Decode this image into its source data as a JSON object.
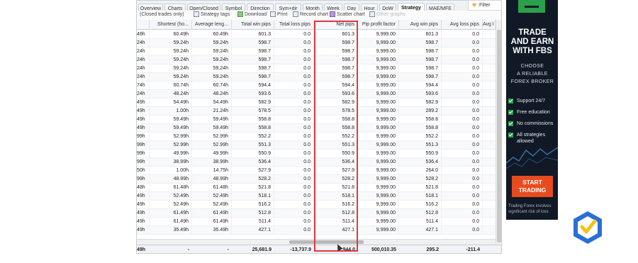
{
  "tabs": [
    {
      "label": "Overview",
      "active": false
    },
    {
      "label": "Charts",
      "active": false
    },
    {
      "label": "Open/Closed",
      "active": false
    },
    {
      "label": "Symbol",
      "active": false
    },
    {
      "label": "Direction",
      "active": false
    },
    {
      "label": "Sym+dir",
      "active": false
    },
    {
      "label": "Month",
      "active": false
    },
    {
      "label": "Week",
      "active": false
    },
    {
      "label": "Day",
      "active": false
    },
    {
      "label": "Hour",
      "active": false
    },
    {
      "label": "DoW",
      "active": false
    },
    {
      "label": "Strategy",
      "active": true
    },
    {
      "label": "MAE/MFE",
      "active": false
    }
  ],
  "filter_label": "Filter",
  "toolbar": {
    "scope": "(Closed trades only)",
    "strategy_tags": "Strategy tags",
    "download": "Download",
    "print": "Print",
    "record_chart": "Record chart",
    "scatter_chart": "Scatter chart",
    "other": "Other graphs"
  },
  "columns": [
    "",
    "Shortest (ho...",
    "Average leng...",
    "Total win pips",
    "Total loss pips",
    "Net pips",
    "Pip profit factor",
    "Avg win pips",
    "Avg loss pips",
    "Avg l"
  ],
  "rows": [
    [
      "49h",
      "60.49h",
      "60.49h",
      "601.3",
      "0.0",
      "601.3",
      "9,999.00",
      "601.3",
      "0.0"
    ],
    [
      "24h",
      "59.24h",
      "59.24h",
      "598.7",
      "0.0",
      "598.7",
      "9,999.00",
      "598.7",
      "0.0"
    ],
    [
      "24h",
      "59.24h",
      "59.24h",
      "598.7",
      "0.0",
      "598.7",
      "9,999.00",
      "598.7",
      "0.0"
    ],
    [
      "24h",
      "59.24h",
      "59.24h",
      "598.7",
      "0.0",
      "598.7",
      "9,999.00",
      "598.7",
      "0.0"
    ],
    [
      "24h",
      "59.24h",
      "59.24h",
      "598.7",
      "0.0",
      "598.7",
      "9,999.00",
      "598.7",
      "0.0"
    ],
    [
      "24h",
      "59.24h",
      "59.24h",
      "598.7",
      "0.0",
      "598.7",
      "9,999.00",
      "598.7",
      "0.0"
    ],
    [
      "74h",
      "60.74h",
      "60.74h",
      "594.4",
      "0.0",
      "594.4",
      "9,999.00",
      "594.4",
      "0.0"
    ],
    [
      "24h",
      "48.24h",
      "48.24h",
      "593.6",
      "0.0",
      "593.6",
      "9,999.00",
      "593.6",
      "0.0"
    ],
    [
      "49h",
      "54.49h",
      "54.49h",
      "582.9",
      "0.0",
      "582.9",
      "9,999.00",
      "582.9",
      "0.0"
    ],
    [
      "49h",
      "1.00h",
      "21.24h",
      "578.5",
      "0.0",
      "578.5",
      "9,999.00",
      "289.2",
      "0.0"
    ],
    [
      "49h",
      "59.49h",
      "59.49h",
      "558.8",
      "0.0",
      "558.8",
      "9,999.00",
      "558.8",
      "0.0"
    ],
    [
      "49h",
      "59.49h",
      "59.49h",
      "558.8",
      "0.0",
      "558.8",
      "9,999.00",
      "558.8",
      "0.0"
    ],
    [
      "99h",
      "52.99h",
      "52.99h",
      "552.2",
      "0.0",
      "552.2",
      "9,999.00",
      "552.2",
      "0.0"
    ],
    [
      "99h",
      "52.99h",
      "52.99h",
      "551.3",
      "0.0",
      "551.3",
      "9,999.00",
      "551.3",
      "0.0"
    ],
    [
      "99h",
      "49.99h",
      "49.99h",
      "550.9",
      "0.0",
      "550.9",
      "9,999.00",
      "550.9",
      "0.0"
    ],
    [
      "99h",
      "38.99h",
      "38.99h",
      "536.4",
      "0.0",
      "536.4",
      "9,999.00",
      "536.4",
      "0.0"
    ],
    [
      "50h",
      "1.00h",
      "14.75h",
      "527.9",
      "0.0",
      "527.9",
      "9,999.00",
      "264.0",
      "0.0"
    ],
    [
      "99h",
      "48.99h",
      "48.99h",
      "528.2",
      "0.0",
      "528.2",
      "9,999.00",
      "528.2",
      "0.0"
    ],
    [
      "48h",
      "61.48h",
      "61.48h",
      "521.8",
      "0.0",
      "521.8",
      "9,999.00",
      "521.8",
      "0.0"
    ],
    [
      "49h",
      "52.49h",
      "52.49h",
      "518.1",
      "0.0",
      "518.1",
      "9,999.00",
      "518.1",
      "0.0"
    ],
    [
      "49h",
      "52.49h",
      "52.49h",
      "516.2",
      "0.0",
      "516.2",
      "9,999.00",
      "516.2",
      "0.0"
    ],
    [
      "49h",
      "61.49h",
      "61.49h",
      "512.8",
      "0.0",
      "512.8",
      "9,999.00",
      "512.8",
      "0.0"
    ],
    [
      "49h",
      "61.49h",
      "61.49h",
      "511.4",
      "0.0",
      "511.4",
      "9,999.00",
      "511.4",
      "0.0"
    ],
    [
      "49h",
      "35.49h",
      "35.49h",
      "427.1",
      "0.0",
      "427.1",
      "9,999.00",
      "427.1",
      "0.0"
    ]
  ],
  "totals": [
    "49h",
    "-",
    "-",
    "25,681.9",
    "-13,737.9",
    "1,944.0",
    "500,010.35",
    "295.2",
    "-211.4"
  ],
  "ad": {
    "headline_1": "TRADE",
    "headline_2": "AND EARN",
    "headline_3": "WITH FBS",
    "sub_1": "CHOOSE",
    "sub_2": "A RELIABLE",
    "sub_3": "FOREX BROKER",
    "features": [
      "Support 24/7",
      "Free education",
      "No commissions",
      "All strategies allowed"
    ],
    "cta_1": "START",
    "cta_2": "TRADING",
    "risk": "Trading Forex involves significant risk of loss"
  },
  "colors": {
    "highlight": "#e0393e",
    "ad_bg": "#101925",
    "ad_green": "#2aa04b",
    "ad_cta": "#e84b1e",
    "brand_blue": "#2a6fd6",
    "brand_yellow": "#f2c318"
  }
}
